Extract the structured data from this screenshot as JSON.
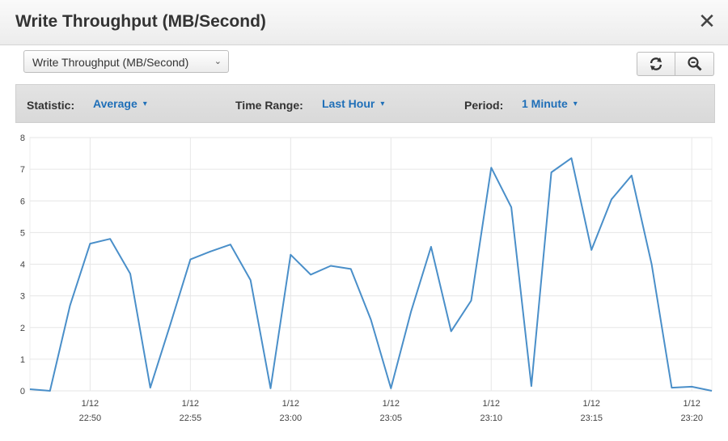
{
  "header": {
    "title": "Write Throughput (MB/Second)",
    "close_icon": "close-icon"
  },
  "metric_select": {
    "value": "Write Throughput (MB/Second)"
  },
  "toolbar": {
    "statistic_label": "Statistic:",
    "statistic_value": "Average",
    "time_range_label": "Time Range:",
    "time_range_value": "Last Hour",
    "period_label": "Period:",
    "period_value": "1 Minute"
  },
  "buttons": {
    "refresh_icon": "refresh-icon",
    "zoom_icon": "zoom-icon"
  },
  "colors": {
    "line": "#4a8fc9",
    "link": "#1f6fb8",
    "grid": "#e6e6e6"
  },
  "chart_data": {
    "type": "line",
    "ylim": [
      0,
      8
    ],
    "yticks": [
      0,
      1,
      2,
      3,
      4,
      5,
      6,
      7,
      8
    ],
    "xticks": [
      {
        "minute": 49.33,
        "date": "1/12",
        "time": "22:50"
      },
      {
        "minute": 54.33,
        "date": "1/12",
        "time": "22:55"
      },
      {
        "minute": 59.33,
        "date": "1/12",
        "time": "23:00"
      },
      {
        "minute": 64.33,
        "date": "1/12",
        "time": "23:05"
      },
      {
        "minute": 69.33,
        "date": "1/12",
        "time": "23:10"
      },
      {
        "minute": 74.33,
        "date": "1/12",
        "time": "23:15"
      },
      {
        "minute": 79.33,
        "date": "1/12",
        "time": "23:20"
      }
    ],
    "series": [
      {
        "x": [
          46.33,
          47.33,
          48.33,
          49.33,
          50.33,
          51.33,
          52.33,
          53.33,
          54.33,
          55.33,
          56.33,
          57.33,
          58.33,
          59.33,
          60.33,
          61.33,
          62.33,
          63.33,
          64.33,
          65.33,
          66.33,
          67.33,
          68.33,
          69.33,
          70.33,
          71.33,
          72.33,
          73.33,
          74.33,
          75.33,
          76.33,
          77.33,
          78.33,
          79.33,
          80.33
        ],
        "y": [
          0.05,
          0.0,
          2.7,
          4.65,
          4.8,
          3.7,
          0.1,
          2.1,
          4.15,
          4.4,
          4.62,
          3.5,
          0.08,
          4.3,
          3.67,
          3.95,
          3.85,
          2.25,
          0.08,
          2.5,
          4.55,
          1.88,
          2.85,
          7.05,
          5.8,
          0.15,
          6.9,
          7.35,
          4.45,
          6.05,
          6.8,
          4.0,
          0.1,
          0.13,
          0.0
        ]
      }
    ]
  }
}
